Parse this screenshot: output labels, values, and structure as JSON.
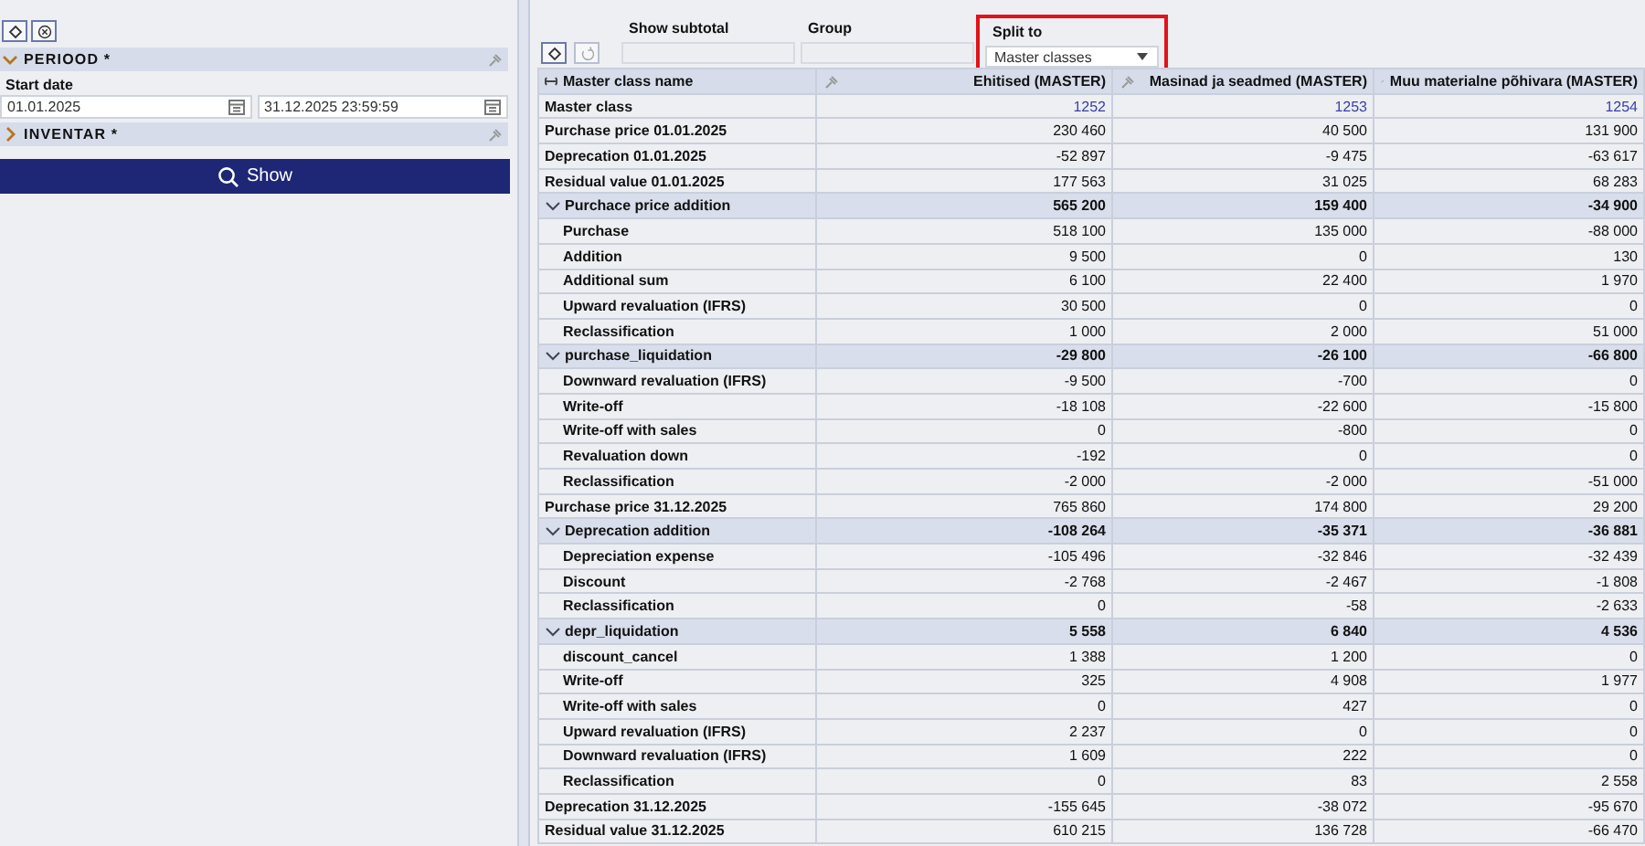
{
  "filter_panel": {
    "sections": [
      {
        "title": "PERIOOD *",
        "expanded": true,
        "fields": [
          {
            "label": "Start date",
            "values": [
              "01.01.2025",
              "31.12.2025 23:59:59"
            ]
          }
        ]
      },
      {
        "title": "INVENTAR *",
        "expanded": false
      }
    ],
    "show_button": "Show"
  },
  "report_options": [
    {
      "label": "Show subtotal"
    },
    {
      "label": "Group"
    },
    {
      "label": "Split to",
      "value": "Master classes",
      "highlighted": true
    }
  ],
  "table": {
    "columns": [
      "Master class name",
      "Ehitised (MASTER)",
      "Masinad ja seadmed (MASTER)",
      "Muu materialne põhivara (MASTER)"
    ],
    "rows": [
      {
        "name": "Master class",
        "kind": "code",
        "values": [
          "1252",
          "1253",
          "1254"
        ]
      },
      {
        "name": "Purchase price 01.01.2025",
        "values": [
          "230 460",
          "40 500",
          "131 900"
        ]
      },
      {
        "name": "Deprecation 01.01.2025",
        "values": [
          "-52 897",
          "-9 475",
          "-63 617"
        ]
      },
      {
        "name": "Residual value 01.01.2025",
        "values": [
          "177 563",
          "31 025",
          "68 283"
        ]
      },
      {
        "name": "Purchace price addition",
        "expanded": true,
        "values": [
          "565 200",
          "159 400",
          "-34 900"
        ],
        "children": [
          {
            "name": "Purchase",
            "values": [
              "518 100",
              "135 000",
              "-88 000"
            ]
          },
          {
            "name": "Addition",
            "values": [
              "9 500",
              "0",
              "130"
            ]
          },
          {
            "name": "Additional sum",
            "values": [
              "6 100",
              "22 400",
              "1 970"
            ]
          },
          {
            "name": "Upward revaluation (IFRS)",
            "values": [
              "30 500",
              "0",
              "0"
            ]
          },
          {
            "name": "Reclassification",
            "values": [
              "1 000",
              "2 000",
              "51 000"
            ]
          }
        ]
      },
      {
        "name": "purchase_liquidation",
        "expanded": true,
        "values": [
          "-29 800",
          "-26 100",
          "-66 800"
        ],
        "children": [
          {
            "name": "Downward revaluation (IFRS)",
            "values": [
              "-9 500",
              "-700",
              "0"
            ]
          },
          {
            "name": "Write-off",
            "values": [
              "-18 108",
              "-22 600",
              "-15 800"
            ]
          },
          {
            "name": "Write-off with sales",
            "values": [
              "0",
              "-800",
              "0"
            ]
          },
          {
            "name": "Revaluation down",
            "values": [
              "-192",
              "0",
              "0"
            ]
          },
          {
            "name": "Reclassification",
            "values": [
              "-2 000",
              "-2 000",
              "-51 000"
            ]
          }
        ]
      },
      {
        "name": "Purchase price 31.12.2025",
        "values": [
          "765 860",
          "174 800",
          "29 200"
        ]
      },
      {
        "name": "Deprecation addition",
        "expanded": true,
        "values": [
          "-108 264",
          "-35 371",
          "-36 881"
        ],
        "children": [
          {
            "name": "Depreciation expense",
            "values": [
              "-105 496",
              "-32 846",
              "-32 439"
            ]
          },
          {
            "name": "Discount",
            "values": [
              "-2 768",
              "-2 467",
              "-1 808"
            ]
          },
          {
            "name": "Reclassification",
            "values": [
              "0",
              "-58",
              "-2 633"
            ]
          }
        ]
      },
      {
        "name": "depr_liquidation",
        "expanded": true,
        "values": [
          "5 558",
          "6 840",
          "4 536"
        ],
        "children": [
          {
            "name": "discount_cancel",
            "values": [
              "1 388",
              "1 200",
              "0"
            ]
          },
          {
            "name": "Write-off",
            "values": [
              "325",
              "4 908",
              "1 977"
            ]
          },
          {
            "name": "Write-off with sales",
            "values": [
              "0",
              "427",
              "0"
            ]
          },
          {
            "name": "Upward revaluation (IFRS)",
            "values": [
              "2 237",
              "0",
              "0"
            ]
          },
          {
            "name": "Downward revaluation (IFRS)",
            "values": [
              "1 609",
              "222",
              "0"
            ]
          },
          {
            "name": "Reclassification",
            "values": [
              "0",
              "83",
              "2 558"
            ]
          }
        ]
      },
      {
        "name": "Deprecation 31.12.2025",
        "values": [
          "-155 645",
          "-38 072",
          "-95 670"
        ]
      },
      {
        "name": "Residual value 31.12.2025",
        "values": [
          "610 215",
          "136 728",
          "-66 470"
        ]
      }
    ]
  }
}
